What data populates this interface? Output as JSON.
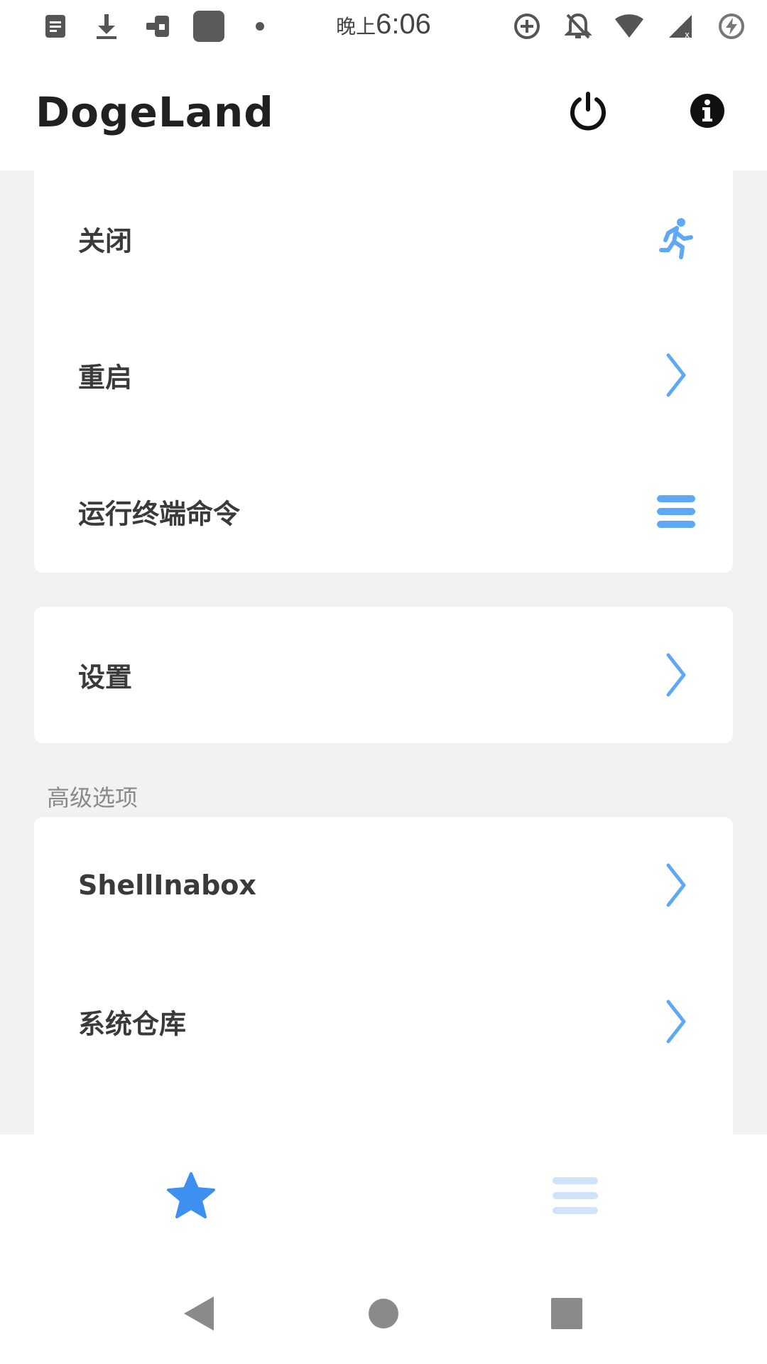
{
  "status_bar": {
    "time_prefix": "晚上",
    "time": "6:06",
    "left_icons": [
      "document-icon",
      "download-icon",
      "transfer-icon",
      "app-square-icon",
      "dot-icon"
    ],
    "right_icons": [
      "data-saver-icon",
      "bell-off-icon",
      "wifi-icon",
      "signal-icon",
      "battery-saver-icon"
    ]
  },
  "app_bar": {
    "title": "DogeLand",
    "actions": [
      "power-icon",
      "info-icon"
    ]
  },
  "colors": {
    "accent": "#5fa8f5",
    "background": "#f2f2f2",
    "card": "#ffffff",
    "text": "#3a3a3a",
    "muted": "#8a8a8a"
  },
  "card1": {
    "items": [
      {
        "label": "关闭",
        "icon": "running-icon"
      },
      {
        "label": "重启",
        "icon": "chevron-right-icon"
      },
      {
        "label": "运行终端命令",
        "icon": "menu-lines-icon"
      }
    ]
  },
  "card2": {
    "items": [
      {
        "label": "设置",
        "icon": "chevron-right-icon"
      }
    ]
  },
  "advanced": {
    "section_title": "高级选项",
    "items": [
      {
        "label": "ShellInabox",
        "icon": "chevron-right-icon"
      },
      {
        "label": "系统仓库",
        "icon": "chevron-right-icon"
      }
    ]
  },
  "bottom_nav": {
    "tabs": [
      {
        "icon": "star-icon",
        "selected": true
      },
      {
        "icon": "menu-icon",
        "selected": false
      }
    ]
  },
  "system_nav": [
    "back-icon",
    "home-icon",
    "recents-icon"
  ]
}
